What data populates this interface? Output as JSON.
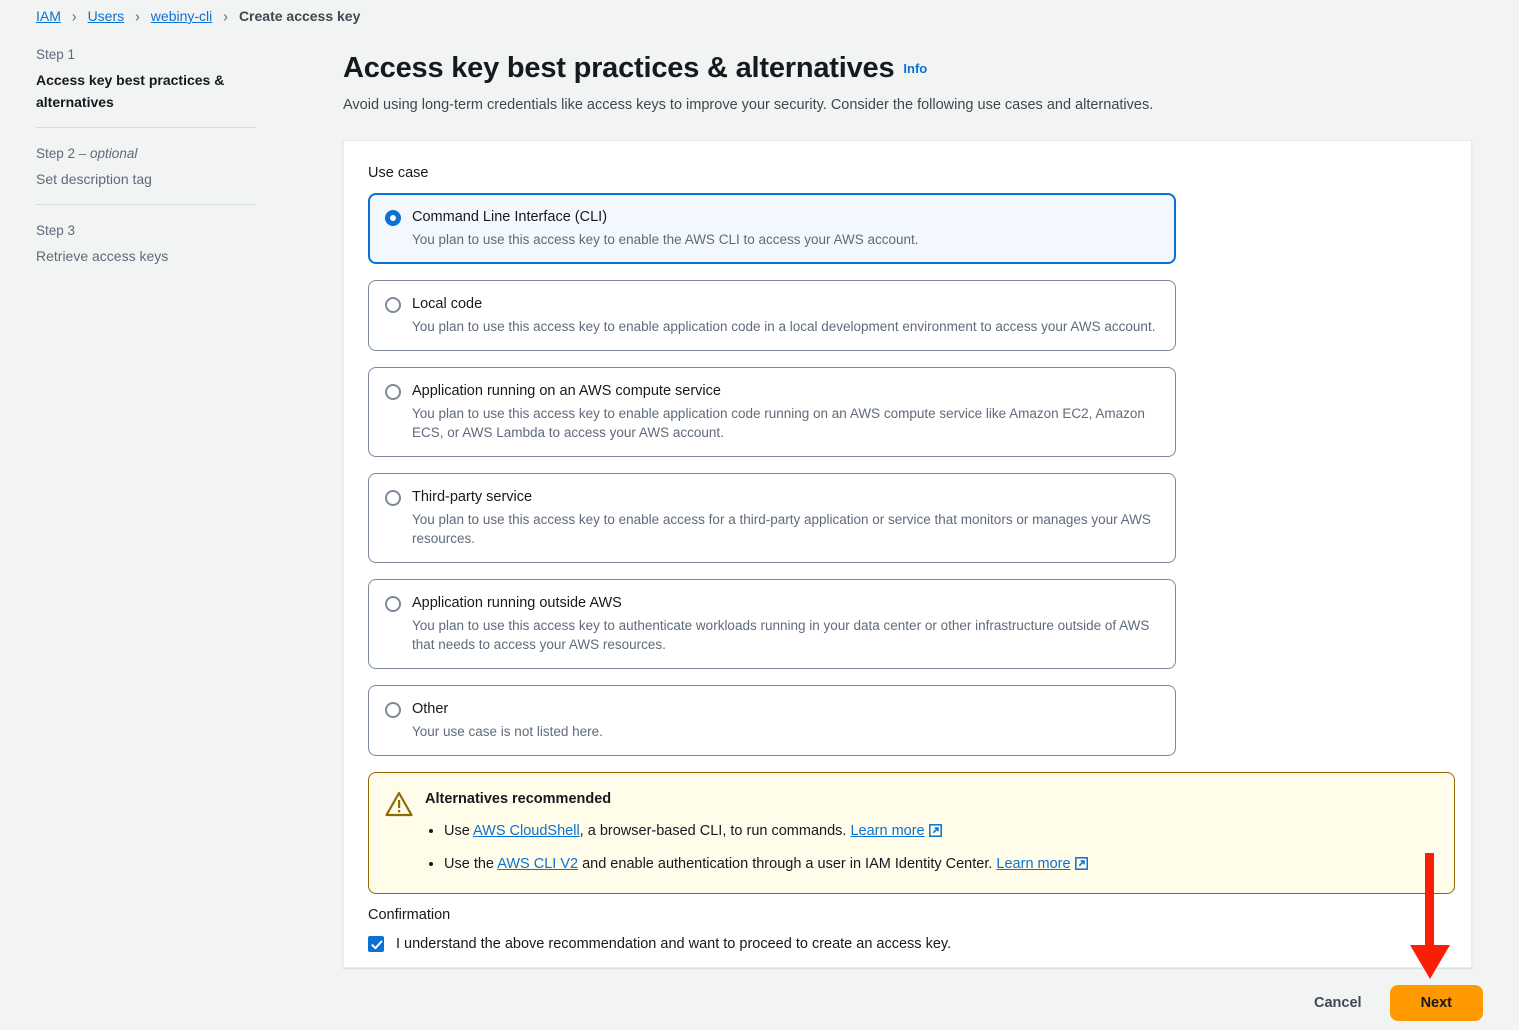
{
  "breadcrumb": {
    "items": [
      {
        "label": "IAM",
        "type": "link"
      },
      {
        "label": "Users",
        "type": "link"
      },
      {
        "label": "webiny-cli",
        "type": "link"
      },
      {
        "label": "Create access key",
        "type": "current"
      }
    ],
    "separator": "›"
  },
  "sidebar": {
    "steps": [
      {
        "step_label": "Step 1",
        "optional_suffix": "",
        "title": "Access key best practices & alternatives",
        "active": true
      },
      {
        "step_label": "Step 2",
        "optional_suffix": " – optional",
        "title": "Set description tag",
        "active": false
      },
      {
        "step_label": "Step 3",
        "optional_suffix": "",
        "title": "Retrieve access keys",
        "active": false
      }
    ]
  },
  "header": {
    "title": "Access key best practices & alternatives",
    "info_label": "Info",
    "description": "Avoid using long-term credentials like access keys to improve your security. Consider the following use cases and alternatives."
  },
  "form": {
    "use_case_label": "Use case",
    "options": [
      {
        "title": "Command Line Interface (CLI)",
        "description": "You plan to use this access key to enable the AWS CLI to access your AWS account.",
        "selected": true
      },
      {
        "title": "Local code",
        "description": "You plan to use this access key to enable application code in a local development environment to access your AWS account.",
        "selected": false
      },
      {
        "title": "Application running on an AWS compute service",
        "description": "You plan to use this access key to enable application code running on an AWS compute service like Amazon EC2, Amazon ECS, or AWS Lambda to access your AWS account.",
        "selected": false
      },
      {
        "title": "Third-party service",
        "description": "You plan to use this access key to enable access for a third-party application or service that monitors or manages your AWS resources.",
        "selected": false
      },
      {
        "title": "Application running outside AWS",
        "description": "You plan to use this access key to authenticate workloads running in your data center or other infrastructure outside of AWS that needs to access your AWS resources.",
        "selected": false
      },
      {
        "title": "Other",
        "description": "Your use case is not listed here.",
        "selected": false
      }
    ]
  },
  "alert": {
    "icon": "warning-triangle-icon",
    "title": "Alternatives recommended",
    "bullets": [
      {
        "prefix": "Use ",
        "link": "AWS CloudShell",
        "middle": ", a browser-based CLI, to run commands. ",
        "learn_more": "Learn more"
      },
      {
        "prefix": "Use the ",
        "link": "AWS CLI V2",
        "middle": " and enable authentication through a user in IAM Identity Center. ",
        "learn_more": "Learn more"
      }
    ]
  },
  "confirmation": {
    "label": "Confirmation",
    "checkbox_text": "I understand the above recommendation and want to proceed to create an access key.",
    "checked": true
  },
  "footer": {
    "cancel_label": "Cancel",
    "next_label": "Next"
  },
  "annotation": {
    "type": "arrow",
    "color": "#f91e05",
    "points_to": "next-button"
  },
  "colors": {
    "accent_blue": "#0972d3",
    "warning_border": "#906806",
    "warning_bg": "#fffce9",
    "next_button": "#ff9900",
    "page_bg": "#f2f3f3"
  }
}
